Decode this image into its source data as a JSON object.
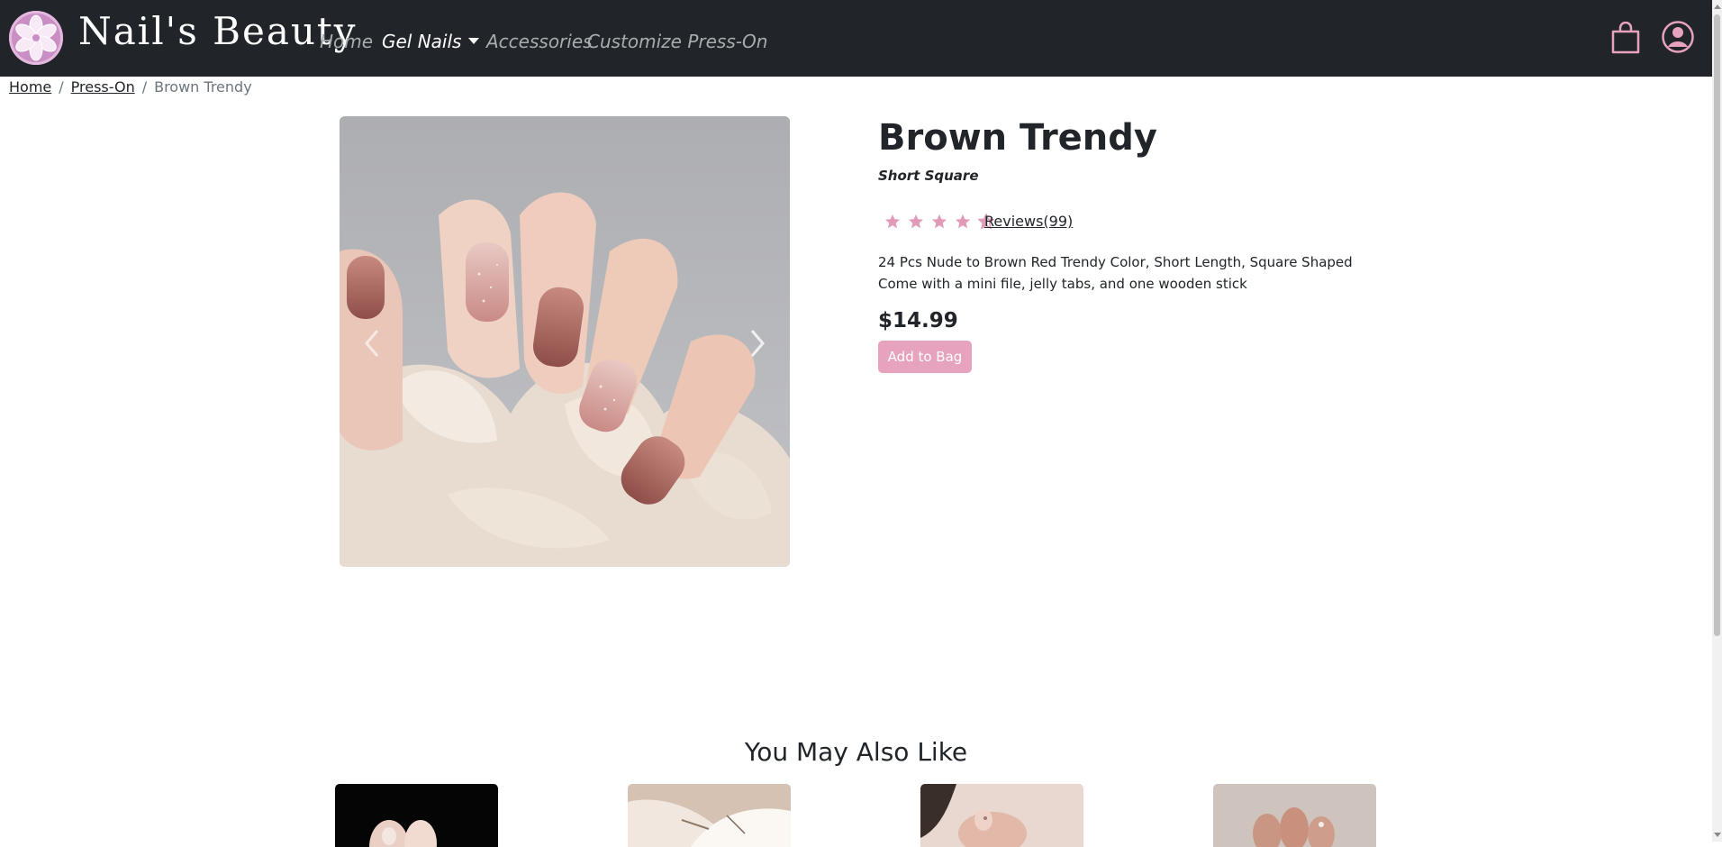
{
  "brand": {
    "name": "Nail's Beauty",
    "logo": "flower-logo-icon"
  },
  "nav": {
    "items": [
      {
        "label": "Home"
      },
      {
        "label": "Gel Nails",
        "dropdown": true,
        "active": true
      },
      {
        "label": "Accessories"
      },
      {
        "label": "Customize Press-On"
      }
    ],
    "icons": [
      "shopping-bag-icon",
      "user-account-icon"
    ]
  },
  "breadcrumb": {
    "items": [
      "Home",
      "Press-On"
    ],
    "current": "Brown Trendy"
  },
  "product": {
    "title": "Brown Trendy",
    "subtitle": "Short Square",
    "rating": 4.5,
    "rating_max": 5,
    "reviews_label": "Reviews(99)",
    "description": [
      "24 Pcs Nude to Brown Red Trendy Color, Short Length, Square Shaped",
      "Come with a mini file, jelly tabs, and one wooden stick"
    ],
    "price": "$14.99",
    "add_button": "Add to Bag"
  },
  "recommendations": {
    "heading": "You May Also Like",
    "count": 4
  },
  "colors": {
    "navbar": "#212529",
    "accent_pink": "#e7a2bd",
    "star_pink": "#e19ab8",
    "logo_purple": "#c98fc4"
  }
}
